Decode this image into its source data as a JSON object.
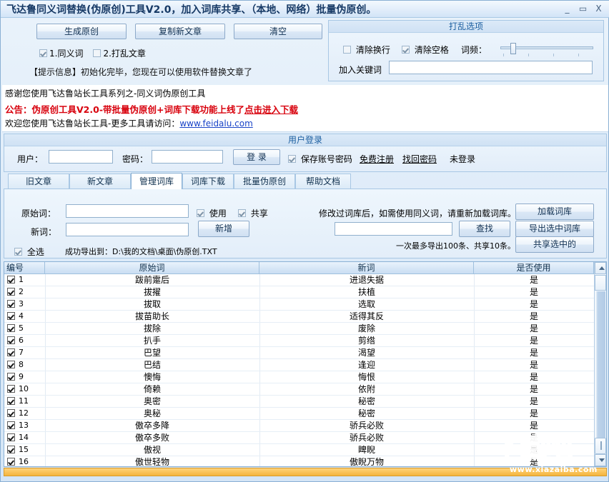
{
  "window": {
    "title": "飞达鲁同义词替换(伪原创)工具V2.0，加入词库共享、（本地、网络）批量伪原创。",
    "minimize": "_",
    "maximize": "▭",
    "close": "X"
  },
  "toolbar": {
    "generate_label": "生成原创",
    "copy_label": "复制新文章",
    "clear_label": "清空",
    "opt_synonym_label": "1.同义词",
    "opt_scramble_label": "2.打乱文章",
    "opt_synonym_checked": true,
    "opt_scramble_checked": false,
    "hint": "【提示信息】初始化完毕，您现在可以使用软件替换文章了"
  },
  "scramble_options": {
    "title": "打乱选项",
    "clear_newline_label": "清除换行",
    "clear_newline_checked": false,
    "clear_space_label": "清除空格",
    "clear_space_checked": true,
    "frequency_label": "词频：",
    "frequency_value": 10,
    "keyword_label": "加入关键词",
    "keyword_value": "",
    "keyword_placeholder": ""
  },
  "notice": {
    "line1": "感谢您使用飞达鲁站长工具系列之-同义词伪原创工具",
    "line2_prefix": "公告：伪原创工具V2.0-带批量伪原创+词库下载功能上线了",
    "line2_link": "点击进入下载",
    "line3_prefix": "欢迎您使用飞达鲁站长工具-更多工具请访问：",
    "line3_link": "www.feidalu.com"
  },
  "login": {
    "title": "用户登录",
    "user_label": "用户：",
    "user_value": "",
    "pass_label": "密码：",
    "pass_value": "",
    "login_button": "登 录",
    "remember_label": "保存账号密码",
    "remember_checked": true,
    "register_link": "免费注册",
    "findpass_link": "找回密码",
    "state": "未登录"
  },
  "tabs": [
    {
      "label": "旧文章",
      "active": false
    },
    {
      "label": "新文章",
      "active": false
    },
    {
      "label": "管理词库",
      "active": true
    },
    {
      "label": "词库下载",
      "active": false
    },
    {
      "label": "批量伪原创",
      "active": false
    },
    {
      "label": "帮助文档",
      "active": false
    }
  ],
  "word_panel": {
    "orig_label": "原始词：",
    "orig_value": "",
    "use_label": "使用",
    "use_checked": true,
    "share_label": "共享",
    "share_checked": true,
    "new_label": "新词：",
    "new_value": "",
    "add_button": "新增",
    "select_all_label": "全选",
    "select_all_checked": true,
    "export_message": "成功导出到：D:\\我的文档\\桌面\\伪原创.TXT",
    "reload_tip": "修改过词库后，如需使用同义词，请重新加载词库。",
    "load_button": "加载词库",
    "search_value": "",
    "find_button": "查找",
    "export_button": "导出选中词库",
    "limit_message": "一次最多导出100条、共享10条。",
    "share_button": "共享选中的"
  },
  "grid": {
    "columns": [
      "编号",
      "原始词",
      "新词",
      "是否使用"
    ],
    "rows": [
      {
        "checked": true,
        "no": "1",
        "orig": "跋前疐后",
        "new": "进退失据",
        "use": "是"
      },
      {
        "checked": true,
        "no": "2",
        "orig": "拔擢",
        "new": "扶植",
        "use": "是"
      },
      {
        "checked": true,
        "no": "3",
        "orig": "拔取",
        "new": "选取",
        "use": "是"
      },
      {
        "checked": true,
        "no": "4",
        "orig": "拔苗助长",
        "new": "适得其反",
        "use": "是"
      },
      {
        "checked": true,
        "no": "5",
        "orig": "拔除",
        "new": "废除",
        "use": "是"
      },
      {
        "checked": true,
        "no": "6",
        "orig": "扒手",
        "new": "剪绺",
        "use": "是"
      },
      {
        "checked": true,
        "no": "7",
        "orig": "巴望",
        "new": "渴望",
        "use": "是"
      },
      {
        "checked": true,
        "no": "8",
        "orig": "巴结",
        "new": "逢迎",
        "use": "是"
      },
      {
        "checked": true,
        "no": "9",
        "orig": "懊悔",
        "new": "悔恨",
        "use": "是"
      },
      {
        "checked": true,
        "no": "10",
        "orig": "倚赖",
        "new": "依附",
        "use": "是"
      },
      {
        "checked": true,
        "no": "11",
        "orig": "奥密",
        "new": "秘密",
        "use": "是"
      },
      {
        "checked": true,
        "no": "12",
        "orig": "奥秘",
        "new": "秘密",
        "use": "是"
      },
      {
        "checked": true,
        "no": "13",
        "orig": "傲卒多降",
        "new": "骄兵必败",
        "use": "是"
      },
      {
        "checked": true,
        "no": "14",
        "orig": "傲卒多败",
        "new": "骄兵必败",
        "use": "是"
      },
      {
        "checked": true,
        "no": "15",
        "orig": "傲视",
        "new": "睥睨",
        "use": "是"
      },
      {
        "checked": true,
        "no": "16",
        "orig": "傲世轻物",
        "new": "傲睨万物",
        "use": "是"
      }
    ]
  },
  "watermark": {
    "text": "下载吧",
    "url": "www.xiazaiba.com"
  }
}
